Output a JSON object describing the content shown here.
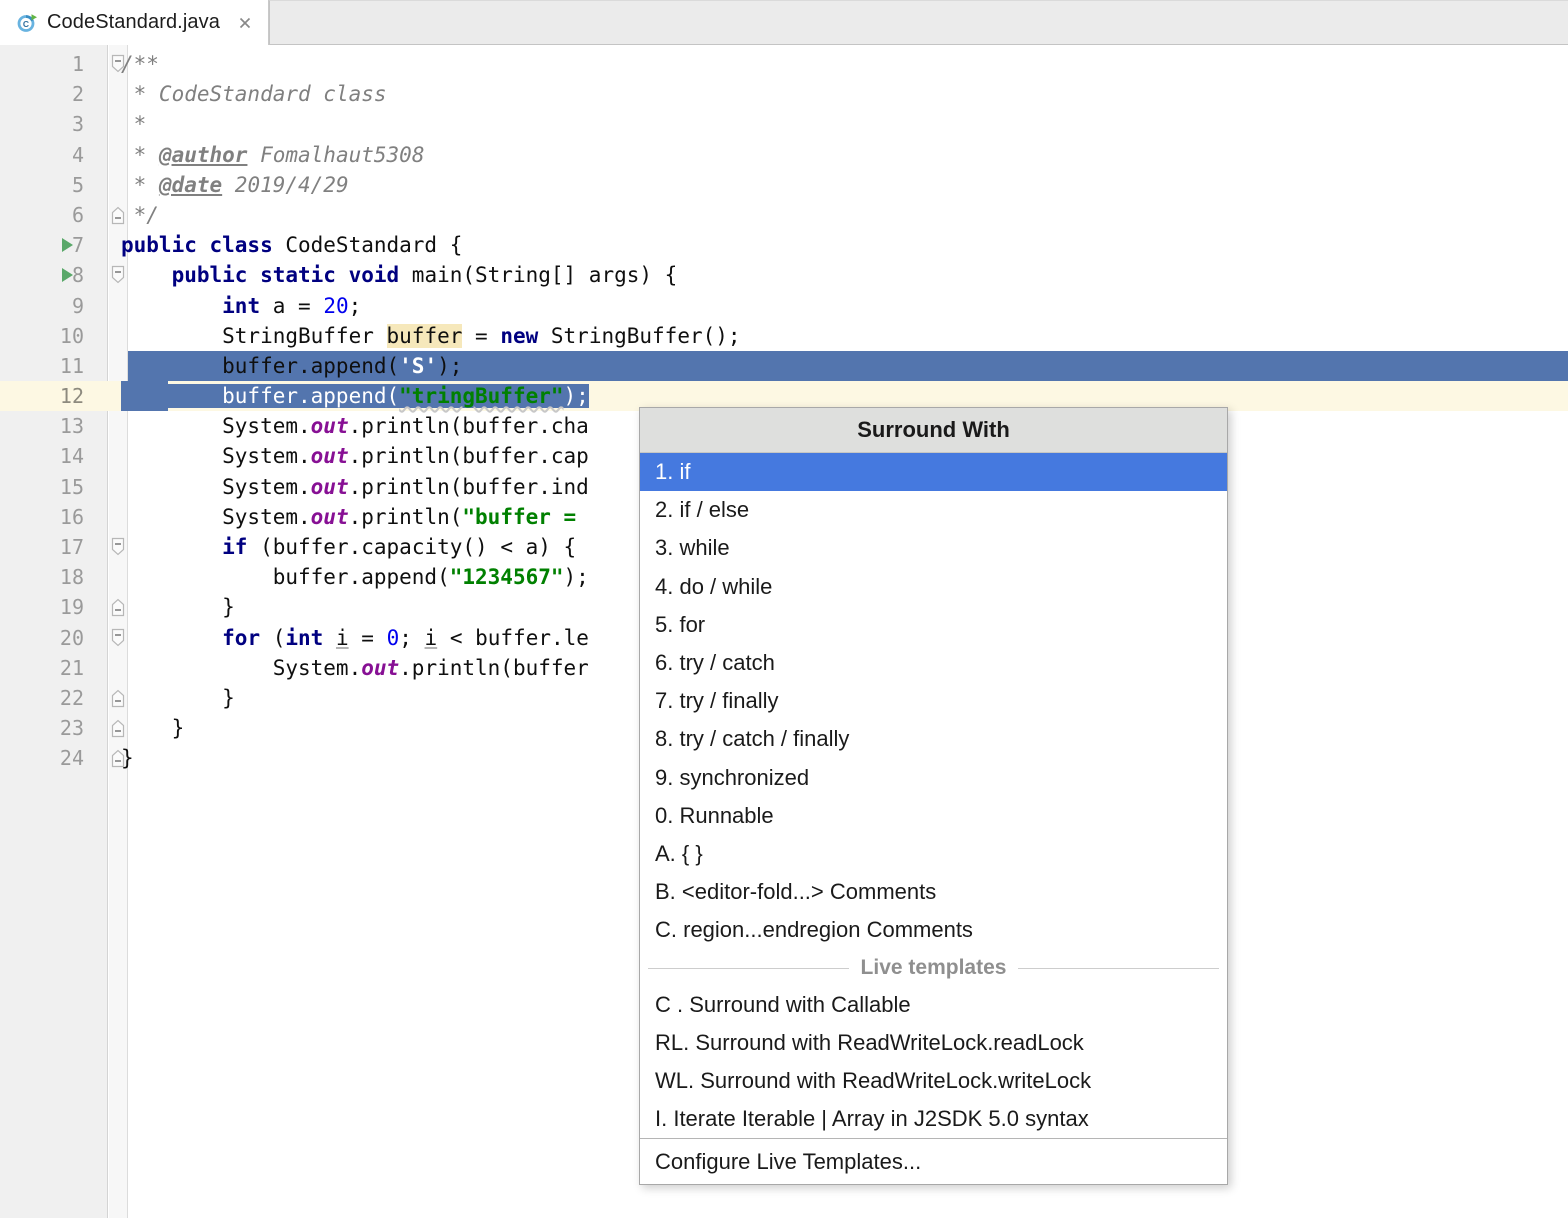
{
  "window": {
    "app": "IntelliJ IDEA Editor"
  },
  "tabbar": {
    "tabs": [
      {
        "label": "CodeStandard.java",
        "icon": "java-class-icon",
        "close_icon": "close-icon",
        "active": true
      }
    ]
  },
  "editor": {
    "gutter_icons": {
      "run": "run-arrow-icon",
      "fold_collapse": "fold-collapse-icon",
      "fold_end": "fold-end-icon"
    },
    "selected_lines": [
      11,
      12
    ],
    "caret_line": 12,
    "colors": {
      "selection": "#5375ae",
      "current_line": "#fdf8e3",
      "keyword": "#000080",
      "string": "#008000",
      "number": "#0000ee",
      "comment": "#808080",
      "field": "#871094",
      "identifier_highlight": "#f6e8bb",
      "gutter_bg": "#f0f0f0",
      "lineno": "#9a9a9a"
    },
    "lines": [
      {
        "n": "1",
        "text": "/**"
      },
      {
        "n": "2",
        "text": " * CodeStandard class"
      },
      {
        "n": "3",
        "text": " *"
      },
      {
        "n": "4",
        "text": " * @author Fomalhaut5308"
      },
      {
        "n": "5",
        "text": " * @date 2019/4/29"
      },
      {
        "n": "6",
        "text": " */"
      },
      {
        "n": "7",
        "text": "public class CodeStandard {"
      },
      {
        "n": "8",
        "text": "    public static void main(String[] args) {"
      },
      {
        "n": "9",
        "text": "        int a = 20;"
      },
      {
        "n": "10",
        "text": "        StringBuffer buffer = new StringBuffer();"
      },
      {
        "n": "11",
        "text": "        buffer.append('S');"
      },
      {
        "n": "12",
        "text": "        buffer.append(\"tringBuffer\");"
      },
      {
        "n": "13",
        "text": "        System.out.println(buffer.cha"
      },
      {
        "n": "14",
        "text": "        System.out.println(buffer.cap"
      },
      {
        "n": "15",
        "text": "        System.out.println(buffer.ind"
      },
      {
        "n": "16",
        "text": "        System.out.println(\"buffer = "
      },
      {
        "n": "17",
        "text": "        if (buffer.capacity() < a) {"
      },
      {
        "n": "18",
        "text": "            buffer.append(\"1234567\");"
      },
      {
        "n": "19",
        "text": "        }"
      },
      {
        "n": "20",
        "text": "        for (int i = 0; i < buffer.le"
      },
      {
        "n": "21",
        "text": "            System.out.println(buffer"
      },
      {
        "n": "22",
        "text": "        }"
      },
      {
        "n": "23",
        "text": "    }"
      },
      {
        "n": "24",
        "text": "}"
      }
    ]
  },
  "popup": {
    "title": "Surround With",
    "items": [
      {
        "label": "1. if",
        "active": true
      },
      {
        "label": "2. if / else",
        "active": false
      },
      {
        "label": "3. while",
        "active": false
      },
      {
        "label": "4. do / while",
        "active": false
      },
      {
        "label": "5. for",
        "active": false
      },
      {
        "label": "6. try / catch",
        "active": false
      },
      {
        "label": "7. try / finally",
        "active": false
      },
      {
        "label": "8. try / catch / finally",
        "active": false
      },
      {
        "label": "9. synchronized",
        "active": false
      },
      {
        "label": "0. Runnable",
        "active": false
      },
      {
        "label": "A. { }",
        "active": false
      },
      {
        "label": "B. <editor-fold...> Comments",
        "active": false
      },
      {
        "label": "C. region...endregion Comments",
        "active": false
      }
    ],
    "separator_label": "Live templates",
    "template_items": [
      {
        "label": "C . Surround with Callable"
      },
      {
        "label": "RL. Surround with ReadWriteLock.readLock"
      },
      {
        "label": "WL. Surround with ReadWriteLock.writeLock"
      },
      {
        "label": "I. Iterate Iterable | Array in J2SDK 5.0 syntax"
      }
    ],
    "footer_label": "Configure Live Templates...",
    "highlight_color": "#4579df",
    "header_bg": "#dedfdd"
  }
}
